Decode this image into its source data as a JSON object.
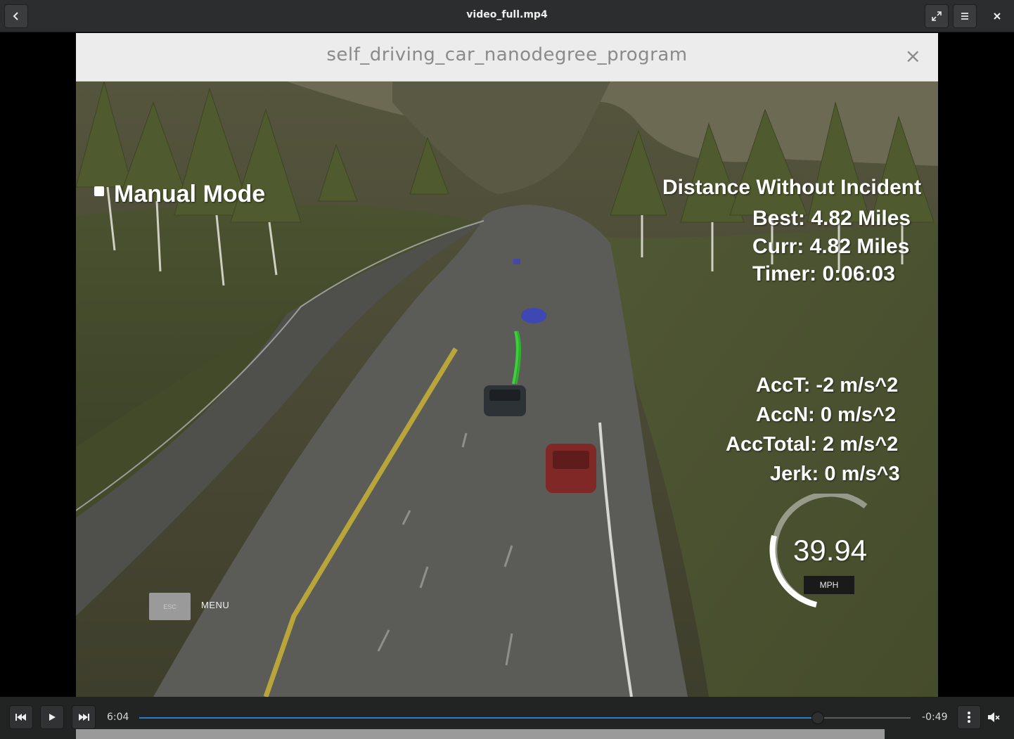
{
  "header": {
    "title": "video_full.mp4",
    "back_icon": "chevron-left-icon",
    "fullscreen_icon": "fullscreen-icon",
    "menu_icon": "hamburger-menu-icon",
    "close_icon": "close-icon"
  },
  "simulator": {
    "window_title": "self_driving_car_nanodegree_program",
    "close_glyph": "×",
    "manual_mode_label": "Manual Mode",
    "distance": {
      "heading": "Distance Without Incident",
      "best": "Best: 4.82 Miles",
      "curr": "Curr: 4.82 Miles",
      "timer": "Timer: 0:06:03"
    },
    "acceleration": {
      "acct": "AccT: -2 m/s^2",
      "accn": "AccN: 0 m/s^2",
      "acctotal": "AccTotal: 2 m/s^2",
      "jerk": "Jerk: 0 m/s^3"
    },
    "speedometer": {
      "value": "39.94",
      "unit": "MPH"
    },
    "esc_key": "ESC",
    "menu_label": "MENU"
  },
  "player": {
    "elapsed": "6:04",
    "remaining": "-0:49",
    "progress": 0.88,
    "accent_color": "#2d7ec8",
    "prev_icon": "skip-back-icon",
    "play_icon": "play-icon",
    "next_icon": "skip-forward-icon",
    "options_icon": "vertical-dots-icon",
    "volume_icon": "volume-muted-icon"
  }
}
